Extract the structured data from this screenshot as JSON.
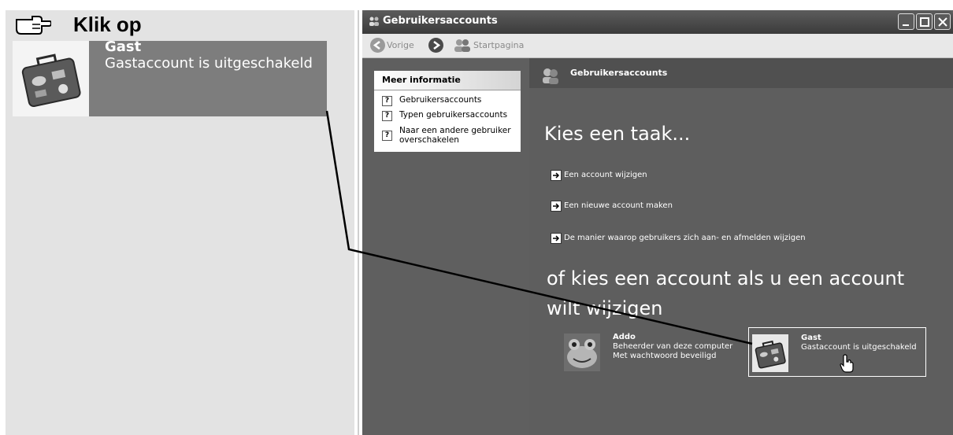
{
  "instruction": {
    "text": "Klik op"
  },
  "zoom": {
    "name": "Gast",
    "status": "Gastaccount is uitgeschakeld"
  },
  "window": {
    "title": "Gebruikersaccounts",
    "toolbar": {
      "back_label": "Vorige",
      "home_label": "Startpagina"
    }
  },
  "sidebar": {
    "title": "Meer informatie",
    "links": [
      "Gebruikersaccounts",
      "Typen gebruikersaccounts",
      "Naar een andere gebruiker overschakelen"
    ]
  },
  "content": {
    "header": "Gebruikersaccounts",
    "task_heading": "Kies een taak...",
    "tasks": [
      "Een account wijzigen",
      "Een nieuwe account maken",
      "De manier waarop gebruikers zich aan- en afmelden wijzigen"
    ],
    "account_heading": "of kies een account als u een account wilt wijzigen",
    "accounts": [
      {
        "name": "Addo",
        "desc": "Beheerder van deze computer\nMet wachtwoord beveiligd"
      },
      {
        "name": "Gast",
        "desc": "Gastaccount is uitgeschakeld"
      }
    ]
  },
  "colors": {
    "window_bg": "#636363",
    "panel_bg": "#e3e3e3",
    "highlight": "#7d7d7d"
  },
  "icons": [
    "pointing-hand-icon",
    "suitcase-icon",
    "frog-icon",
    "back-arrow-icon",
    "forward-arrow-icon",
    "users-icon",
    "help-icon",
    "arrow-right-icon",
    "hand-cursor-icon"
  ]
}
